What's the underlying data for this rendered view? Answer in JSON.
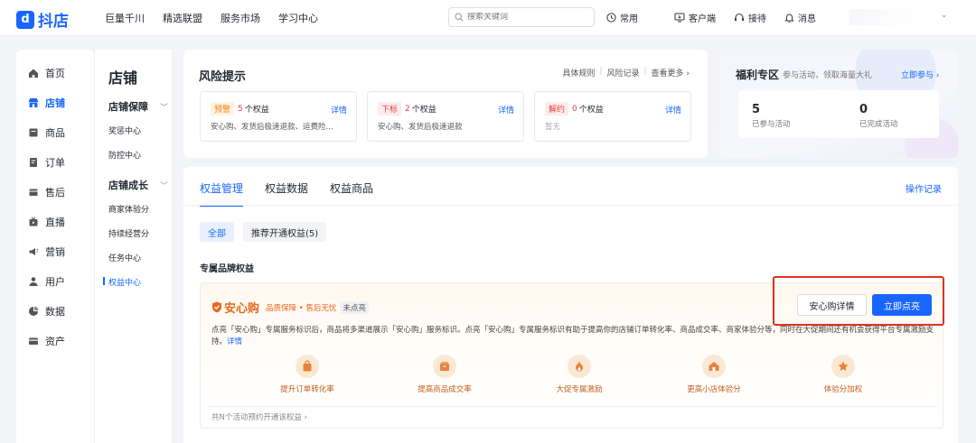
{
  "app": {
    "name": "抖店",
    "logo_glyph": "d"
  },
  "topnav": {
    "items": [
      "巨量千川",
      "精选联盟",
      "服务市场",
      "学习中心"
    ]
  },
  "search": {
    "placeholder": "搜索关键词"
  },
  "tools": {
    "common": "常用",
    "client": "客户端",
    "reception": "接待",
    "messages": "消息"
  },
  "sidebar": {
    "items": [
      {
        "label": "首页",
        "icon": "home-icon"
      },
      {
        "label": "店铺",
        "icon": "store-icon",
        "active": true
      },
      {
        "label": "商品",
        "icon": "product-icon"
      },
      {
        "label": "订单",
        "icon": "order-icon"
      },
      {
        "label": "售后",
        "icon": "after-sale-icon"
      },
      {
        "label": "直播",
        "icon": "live-icon"
      },
      {
        "label": "营销",
        "icon": "marketing-icon"
      },
      {
        "label": "用户",
        "icon": "user-icon"
      },
      {
        "label": "数据",
        "icon": "data-icon"
      },
      {
        "label": "资产",
        "icon": "asset-icon"
      }
    ]
  },
  "subnav": {
    "title": "店铺",
    "groups": [
      {
        "label": "店铺保障",
        "items": [
          "奖惩中心",
          "防控中心"
        ]
      },
      {
        "label": "店铺成长",
        "items": [
          "商家体验分",
          "持续经营分",
          "任务中心",
          "权益中心"
        ]
      }
    ],
    "active_item": "权益中心"
  },
  "risk": {
    "title": "风险提示",
    "links": [
      "具体规则",
      "风险记录",
      "查看更多"
    ],
    "cards": [
      {
        "tag": "预警",
        "count": "5",
        "unit": "个权益",
        "detail": "详情",
        "desc": "安心购、发货后极速退款、运费险..."
      },
      {
        "tag": "下标",
        "count": "2",
        "unit": "个权益",
        "detail": "详情",
        "desc": "安心购、发货后极速退款"
      },
      {
        "tag": "解约",
        "count": "0",
        "unit": "个权益",
        "detail": "详情",
        "desc": "暂无"
      }
    ]
  },
  "welfare": {
    "title": "福利专区",
    "subtitle": "参与活动，领取海量大礼",
    "link": "立即参与",
    "stats": [
      {
        "value": "5",
        "label": "已参与活动"
      },
      {
        "value": "0",
        "label": "已完成活动"
      }
    ]
  },
  "main": {
    "tabs": [
      "权益管理",
      "权益数据",
      "权益商品"
    ],
    "active_tab": "权益管理",
    "op_log": "操作记录",
    "chips": [
      "全部",
      "推荐开通权益(5)"
    ],
    "section_title": "专属品牌权益",
    "brand": {
      "name": "安心购",
      "tagline": "品质保障 • 售后无忧",
      "state": "未点亮",
      "desc": "点亮「安心购」专属服务标识后，商品将多渠道展示「安心购」服务标识。点亮「安心购」专属服务标识有助于提高你的店铺订单转化率、商品成交率、商家体验分等，同时在大促期间还有机会获得平台专属激励支持。",
      "desc_link": "详情",
      "btn_detail": "安心购详情",
      "btn_light": "立即点亮",
      "benefits": [
        {
          "label": "提升订单转化率",
          "icon": "bag-icon"
        },
        {
          "label": "提高商品成交率",
          "icon": "box-icon"
        },
        {
          "label": "大促专属激励",
          "icon": "flame-icon"
        },
        {
          "label": "更高小店体验分",
          "icon": "shop-icon"
        },
        {
          "label": "体验分加权",
          "icon": "star-icon"
        }
      ],
      "footer": "共N个活动预约开通该权益"
    }
  },
  "colors": {
    "brand_blue": "#1966ff",
    "highlight_red": "#e0311e",
    "brand_orange": "#e86a1f"
  }
}
